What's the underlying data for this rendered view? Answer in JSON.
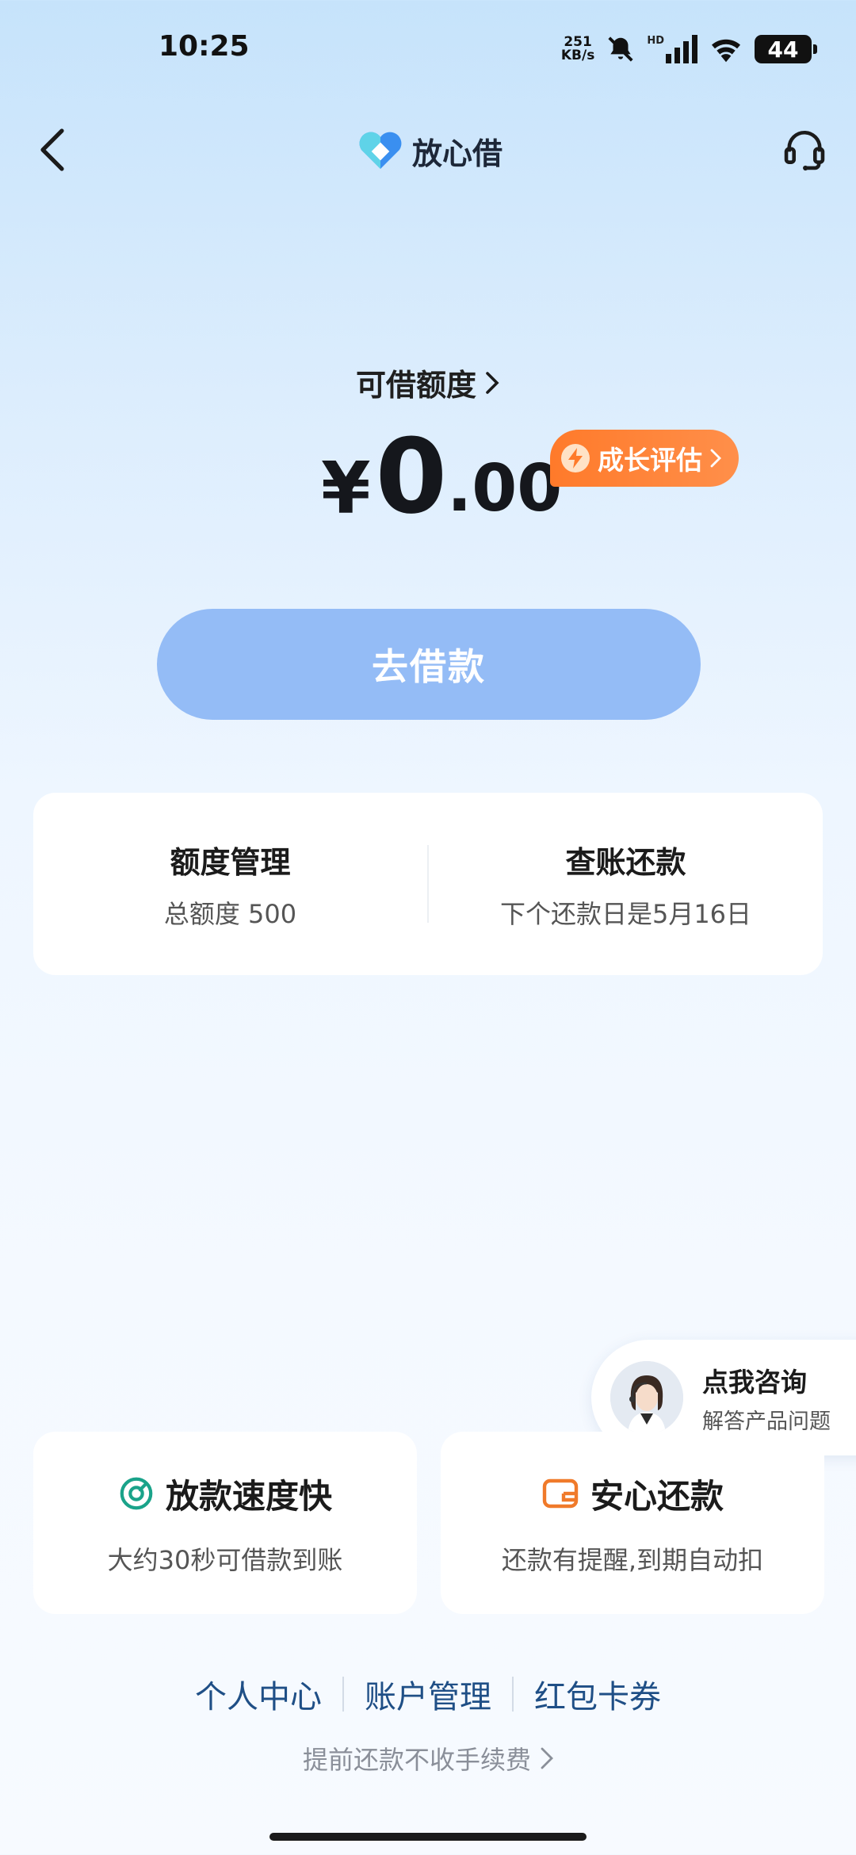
{
  "status_bar": {
    "time": "10:25",
    "net_speed_value": "251",
    "net_speed_unit": "KB/s",
    "hd_label": "HD",
    "battery": "44",
    "icons": [
      "mute-bell-icon",
      "signal-icon",
      "wifi-icon",
      "battery-icon"
    ]
  },
  "nav": {
    "brand_name": "放心借",
    "back_icon": "chevron-left-icon",
    "support_icon": "headset-icon"
  },
  "credit": {
    "label": "可借额度",
    "currency": "¥",
    "amount_int": "0",
    "amount_dec": ".00",
    "growth_button": "成长评估",
    "borrow_button": "去借款"
  },
  "management": {
    "left_title": "额度管理",
    "left_sub": "总额度 500",
    "right_title": "查账还款",
    "right_sub": "下个还款日是5月16日"
  },
  "consult": {
    "title": "点我咨询",
    "subtitle": "解答产品问题"
  },
  "features": [
    {
      "title": "放款速度快",
      "subtitle": "大约30秒可借款到账",
      "icon": "speedometer-icon",
      "color": "#1aa38a"
    },
    {
      "title": "安心还款",
      "subtitle": "还款有提醒,到期自动扣",
      "icon": "wallet-icon",
      "color": "#f07a2a"
    }
  ],
  "links": [
    "个人中心",
    "账户管理",
    "红包卡券"
  ],
  "footer_note": "提前还款不收手续费",
  "colors": {
    "accent_blue": "#94bcf6",
    "growth_orange": "#ff7a2a",
    "link_blue": "#1f4f86"
  }
}
